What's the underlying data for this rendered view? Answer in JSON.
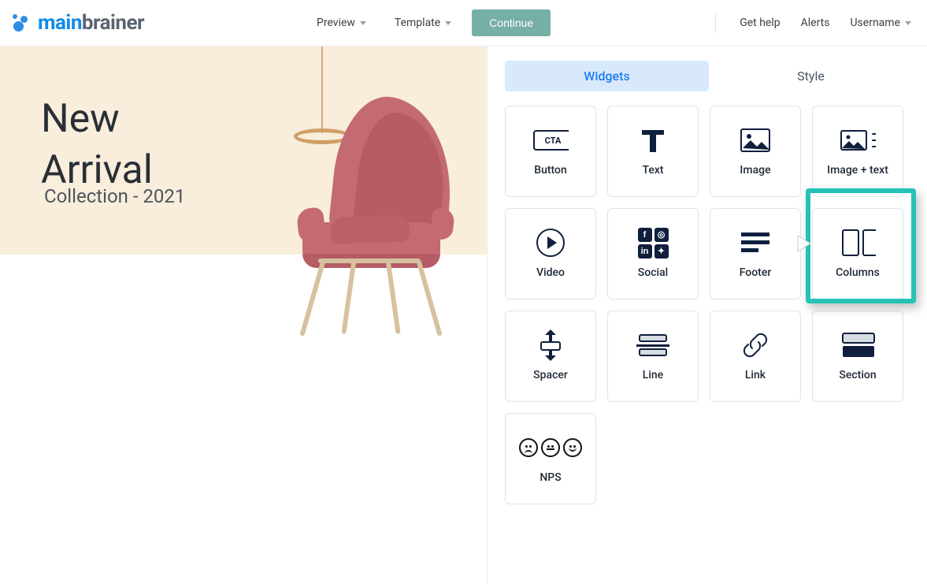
{
  "brand": {
    "name_a": "main",
    "name_b": "brainer"
  },
  "topnav": {
    "preview": "Preview",
    "template": "Template",
    "continue": "Continue"
  },
  "rightnav": {
    "help": "Get help",
    "alerts": "Alerts",
    "username": "Username"
  },
  "hero": {
    "title_l1": "New",
    "title_l2": "Arrival",
    "subtitle": "Collection - 2021"
  },
  "tabs": {
    "widgets": "Widgets",
    "style": "Style"
  },
  "widgets": {
    "button": "Button",
    "text": "Text",
    "image": "Image",
    "image_text": "Image + text",
    "video": "Video",
    "social": "Social",
    "footer": "Footer",
    "columns": "Columns",
    "spacer": "Spacer",
    "line": "Line",
    "link": "Link",
    "section": "Section",
    "nps": "NPS"
  },
  "cta_badge": "CTA"
}
